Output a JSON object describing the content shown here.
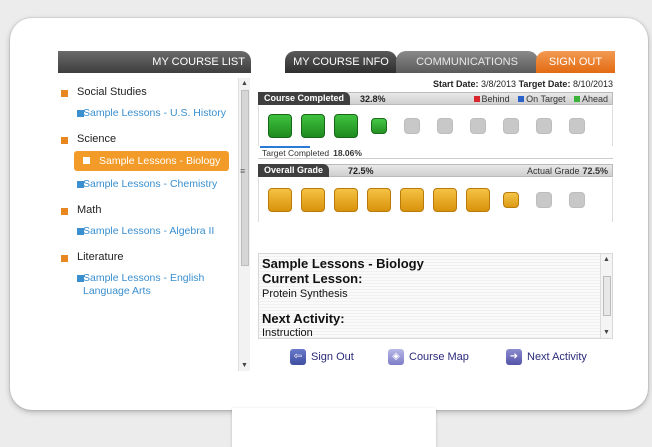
{
  "nav": {
    "tabs": [
      {
        "label": "MY COURSE LIST"
      },
      {
        "label": "MY COURSE INFO"
      },
      {
        "label": "COMMUNICATIONS"
      },
      {
        "label": "SIGN OUT"
      }
    ]
  },
  "sidebar": {
    "categories": [
      {
        "label": "Social Studies",
        "items": [
          {
            "label": "Sample Lessons - U.S. History"
          }
        ]
      },
      {
        "label": "Science",
        "items": [
          {
            "label": "Sample Lessons - Biology",
            "active": true
          },
          {
            "label": "Sample Lessons - Chemistry"
          }
        ]
      },
      {
        "label": "Math",
        "items": [
          {
            "label": "Sample Lessons - Algebra II"
          }
        ]
      },
      {
        "label": "Literature",
        "items": [
          {
            "label": "Sample Lessons - English Language Arts"
          }
        ]
      }
    ]
  },
  "dates": {
    "start_label": "Start Date:",
    "start_value": "3/8/2013",
    "target_label": "Target Date:",
    "target_value": "8/10/2013"
  },
  "course_completed": {
    "label": "Course Completed",
    "percent": "32.8%",
    "legend": [
      {
        "label": "Behind",
        "color": "#d9262c"
      },
      {
        "label": "On Target",
        "color": "#2a62c9"
      },
      {
        "label": "Ahead",
        "color": "#3bb33b"
      }
    ],
    "target_label": "Target Completed",
    "target_percent": "18.06%",
    "target_fraction": 0.1806,
    "completed_fraction": 0.328
  },
  "overall_grade": {
    "label": "Overall Grade",
    "percent": "72.5%",
    "actual_label": "Actual Grade",
    "actual_percent": "72.5%",
    "fraction": 0.725
  },
  "lesson": {
    "course_title": "Sample Lessons - Biology",
    "current_lesson_label": "Current Lesson:",
    "current_lesson_value": "Protein Synthesis",
    "next_activity_label": "Next Activity:",
    "next_activity_value": "Instruction"
  },
  "actions": {
    "sign_out": "Sign Out",
    "course_map": "Course Map",
    "next_activity": "Next Activity"
  },
  "colors": {
    "accent_orange": "#f29b28",
    "link_blue": "#3a8fcf",
    "tile_green": "#2aa02a",
    "tile_gold": "#e8a820"
  }
}
